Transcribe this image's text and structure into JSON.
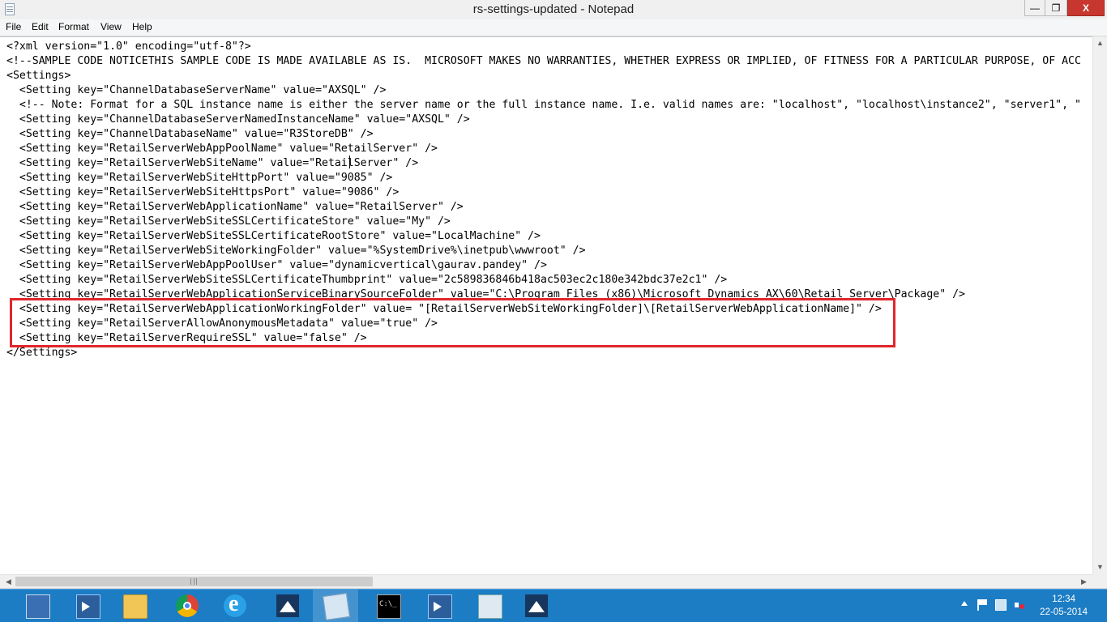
{
  "window": {
    "title": "rs-settings-updated - Notepad",
    "buttons": {
      "minimize": "—",
      "maximize": "❐",
      "close": "X"
    }
  },
  "menu": {
    "file": "File",
    "edit": "Edit",
    "format": "Format",
    "view": "View",
    "help": "Help"
  },
  "document": {
    "lines": [
      "<?xml version=\"1.0\" encoding=\"utf-8\"?>",
      "<!--SAMPLE CODE NOTICETHIS SAMPLE CODE IS MADE AVAILABLE AS IS.  MICROSOFT MAKES NO WARRANTIES, WHETHER EXPRESS OR IMPLIED, OF FITNESS FOR A PARTICULAR PURPOSE, OF ACC",
      "<Settings>",
      "  <Setting key=\"ChannelDatabaseServerName\" value=\"AXSQL\" />",
      "  <!-- Note: Format for a SQL instance name is either the server name or the full instance name. I.e. valid names are: \"localhost\", \"localhost\\instance2\", \"server1\", \"",
      "  <Setting key=\"ChannelDatabaseServerNamedInstanceName\" value=\"AXSQL\" />",
      "  <Setting key=\"ChannelDatabaseName\" value=\"R3StoreDB\" />",
      "  <Setting key=\"RetailServerWebAppPoolName\" value=\"RetailServer\" />",
      "  <Setting key=\"RetailServerWebSiteName\" value=\"RetailServer\" />",
      "  <Setting key=\"RetailServerWebSiteHttpPort\" value=\"9085\" />",
      "  <Setting key=\"RetailServerWebSiteHttpsPort\" value=\"9086\" />",
      "  <Setting key=\"RetailServerWebApplicationName\" value=\"RetailServer\" />",
      "  <Setting key=\"RetailServerWebSiteSSLCertificateStore\" value=\"My\" />",
      "  <Setting key=\"RetailServerWebSiteSSLCertificateRootStore\" value=\"LocalMachine\" />",
      "  <Setting key=\"RetailServerWebSiteWorkingFolder\" value=\"%SystemDrive%\\inetpub\\wwwroot\" />",
      "  <Setting key=\"RetailServerWebAppPoolUser\" value=\"dynamicvertical\\gaurav.pandey\" />",
      "  <Setting key=\"RetailServerWebSiteSSLCertificateThumbprint\" value=\"2c589836846b418ac503ec2c180e342bdc37e2c1\" />",
      "  <Setting key=\"RetailServerWebApplicationServiceBinarySourceFolder\" value=\"C:\\Program Files (x86)\\Microsoft Dynamics AX\\60\\Retail Server\\Package\" />",
      "  <Setting key=\"RetailServerWebApplicationWorkingFolder\" value= \"[RetailServerWebSiteWorkingFolder]\\[RetailServerWebApplicationName]\" />",
      "  <Setting key=\"RetailServerAllowAnonymousMetadata\" value=\"true\" />",
      "  <Setting key=\"RetailServerRequireSSL\" value=\"false\" />",
      "</Settings>"
    ]
  },
  "scrollbars": {
    "up": "▲",
    "down": "▼",
    "left": "◀",
    "right": "▶"
  },
  "taskbar": {
    "items": [
      {
        "name": "server-manager-icon"
      },
      {
        "name": "powershell-icon"
      },
      {
        "name": "file-explorer-icon"
      },
      {
        "name": "chrome-icon"
      },
      {
        "name": "internet-explorer-icon"
      },
      {
        "name": "dynamics-ax-icon"
      },
      {
        "name": "notepad-icon"
      },
      {
        "name": "command-prompt-icon"
      },
      {
        "name": "powershell-icon"
      },
      {
        "name": "server-tools-icon"
      },
      {
        "name": "dynamics-ax-icon"
      }
    ],
    "clock": {
      "time": "12:34",
      "date": "22-05-2014"
    }
  },
  "colors": {
    "highlight_box": "#e0262b",
    "taskbar": "#1c7cc4",
    "close_button": "#c7372f"
  }
}
